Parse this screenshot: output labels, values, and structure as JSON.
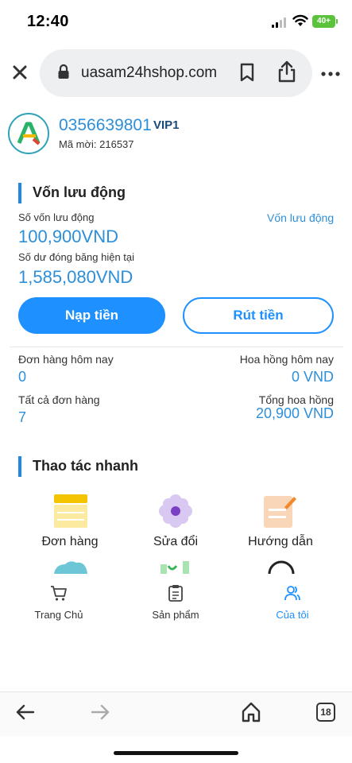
{
  "status_bar": {
    "time": "12:40",
    "battery": "40+"
  },
  "browser": {
    "url": "uasam24hshop.com",
    "tab_count": "18"
  },
  "profile": {
    "phone": "0356639801",
    "vip": "VIP1",
    "invite_code": "Mã mời: 216537"
  },
  "working_capital": {
    "title": "Vốn lưu động",
    "capital_label": "Số vốn lưu động",
    "capital_link": "Vốn lưu động",
    "capital_value": "100,900VND",
    "frozen_label": "Số dư đóng băng hiện tại",
    "frozen_value": "1,585,080VND",
    "deposit_label": "Nạp tiền",
    "withdraw_label": "Rút tiền"
  },
  "stats": {
    "orders_today_label": "Đơn hàng hôm nay",
    "orders_today_value": "0",
    "commission_today_label": "Hoa hồng hôm nay",
    "commission_today_value": "0 VND",
    "all_orders_label": "Tất cả đơn hàng",
    "all_orders_value": "7",
    "total_commission_label": "Tổng hoa hồng",
    "total_commission_value": "20,900 VND"
  },
  "quick_actions": {
    "title": "Thao tác nhanh",
    "items": [
      {
        "label": "Đơn hàng",
        "icon": "order-list-icon"
      },
      {
        "label": "Sửa đổi",
        "icon": "flower-settings-icon"
      },
      {
        "label": "Hướng dẫn",
        "icon": "guide-note-icon"
      }
    ]
  },
  "bottom_nav": [
    {
      "label": "Trang Chủ",
      "icon": "cart-icon",
      "active": false
    },
    {
      "label": "Sản phẩm",
      "icon": "clipboard-icon",
      "active": false
    },
    {
      "label": "Của tôi",
      "icon": "users-icon",
      "active": true
    }
  ],
  "colors": {
    "primary": "#1e90ff",
    "accent_text": "#2d8fd8",
    "battery": "#5bc23c"
  }
}
